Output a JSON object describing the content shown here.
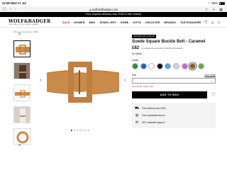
{
  "status_bar": {
    "time": "22:58",
    "date": "Wed 17 Jul",
    "battery": "65%"
  },
  "browser": {
    "url": "wolfandbadger.com"
  },
  "promo": "Free express delivery over £150 & free returns",
  "header": {
    "logo": "WOLF&BADGER",
    "logo_sub": "THE HOME OF INDEPENDENT BRANDS",
    "nav": [
      "SALE",
      "WOMEN",
      "MEN",
      "JEWELLERY",
      "HOME",
      "GIFTS",
      "DISCOVER",
      "BRANDS",
      "TASTEMAKERS"
    ]
  },
  "breadcrumb": "Women / Accessories / Belts",
  "product": {
    "badge": "ONLINE EXCLUSIVE",
    "title": "Suede Square Buckle Belt - Caramel",
    "price": "£82",
    "klarna": "or 4 interest-free payments of £20.50 with clearpay",
    "brand": "By Betillia",
    "colour_label": "Colour",
    "swatches": [
      "#2e8b3a",
      "#1d5fd0",
      "#ffffff",
      "#111111",
      "#4aa3e0",
      "#d9c8e8",
      "#c46bd2",
      "#8b5a2b",
      "#5fae4a"
    ],
    "selected_swatch_index": 7,
    "size_label": "Size",
    "size_guide": "Size Guide",
    "size_select": "",
    "low_stock": "Low Stock - Only 1 left",
    "add_to_bag": "ADD TO BAG"
  },
  "perks": [
    {
      "icon": "truck-icon",
      "text": "Free delivery over £150"
    },
    {
      "icon": "globe-icon",
      "text": "Free worldwide returns"
    },
    {
      "icon": "chat-icon",
      "text": "24/7 customer support"
    }
  ]
}
